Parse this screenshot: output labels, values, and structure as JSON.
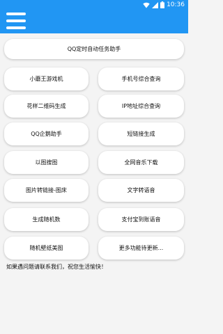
{
  "status_bar": {
    "time": "10:36",
    "icons": [
      "wifi-icon",
      "signal-icon",
      "battery-icon"
    ]
  },
  "header": {
    "accent_color": "#2196f3",
    "menu_icon": "menu-icon"
  },
  "main": {
    "wide_button": "QQ定时自动任务助手",
    "rows": [
      {
        "left": "小蘑王游戏机",
        "right": "手机号综合查询"
      },
      {
        "left": "花样二维码生成",
        "right": "IP地址综合查询"
      },
      {
        "left": "QQ企鹅助手",
        "right": "短链接生成"
      },
      {
        "left": "以图搜图",
        "right": "全网音乐下载"
      },
      {
        "left": "图片转链接-图床",
        "right": "文字转语音"
      },
      {
        "left": "生成随机数",
        "right": "支付宝到账语音"
      },
      {
        "left": "随机壁纸美图",
        "right": "更多功能待更新..."
      }
    ],
    "footer": "如果遇问题请联系我们，祝您生活愉快！"
  }
}
